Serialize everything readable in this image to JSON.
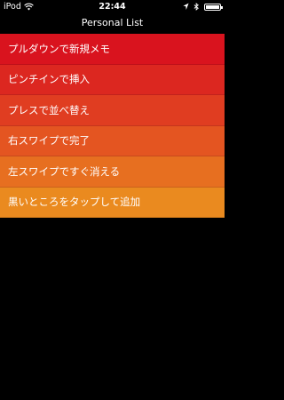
{
  "status_bar": {
    "carrier": "iPod",
    "time": "22:44"
  },
  "nav": {
    "title": "Personal List"
  },
  "list": {
    "items": [
      {
        "label": "プルダウンで新規メモ",
        "color": "#D9131E"
      },
      {
        "label": "ピンチインで挿入",
        "color": "#DC2720"
      },
      {
        "label": "プレスで並べ替え",
        "color": "#E03D21"
      },
      {
        "label": "右スワイプで完了",
        "color": "#E45521"
      },
      {
        "label": "左スワイプですぐ消える",
        "color": "#E76F20"
      },
      {
        "label": "黒いところをタップして追加",
        "color": "#EA8A1F"
      }
    ]
  }
}
